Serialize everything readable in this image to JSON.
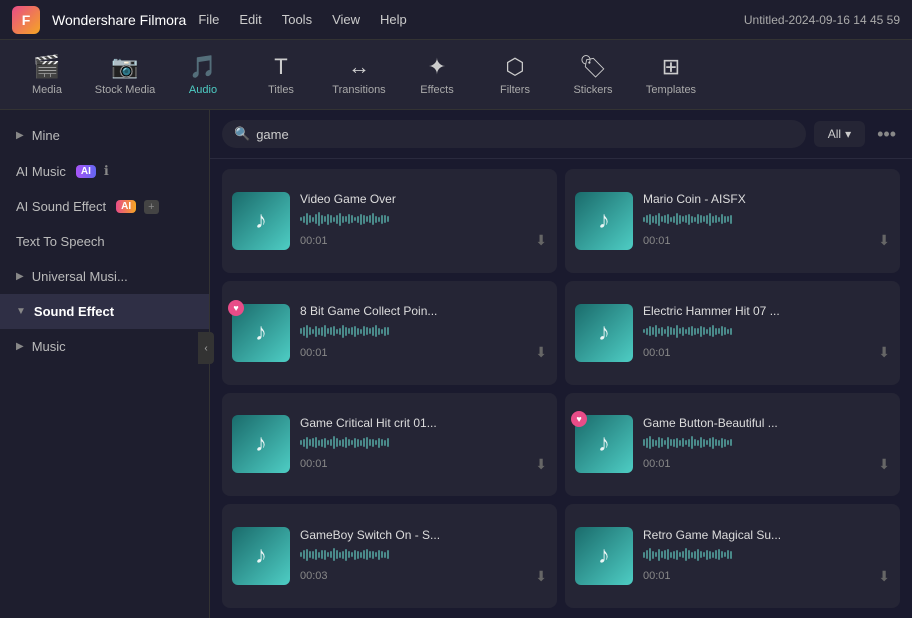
{
  "app": {
    "logo": "F",
    "name": "Wondershare Filmora",
    "menu": [
      "File",
      "Edit",
      "Tools",
      "View",
      "Help"
    ],
    "title": "Untitled-2024-09-16 14 45 59"
  },
  "toolbar": {
    "items": [
      {
        "id": "media",
        "label": "Media",
        "icon": "🎬",
        "active": false
      },
      {
        "id": "stock-media",
        "label": "Stock Media",
        "icon": "📷",
        "active": false
      },
      {
        "id": "audio",
        "label": "Audio",
        "icon": "🎵",
        "active": true
      },
      {
        "id": "titles",
        "label": "Titles",
        "icon": "T",
        "active": false
      },
      {
        "id": "transitions",
        "label": "Transitions",
        "icon": "↔",
        "active": false
      },
      {
        "id": "effects",
        "label": "Effects",
        "icon": "✦",
        "active": false
      },
      {
        "id": "filters",
        "label": "Filters",
        "icon": "⬡",
        "active": false
      },
      {
        "id": "stickers",
        "label": "Stickers",
        "icon": "🏷",
        "active": false
      },
      {
        "id": "templates",
        "label": "Templates",
        "icon": "⊞",
        "active": false
      }
    ]
  },
  "sidebar": {
    "items": [
      {
        "id": "mine",
        "label": "Mine",
        "type": "expandable",
        "active": false
      },
      {
        "id": "ai-music",
        "label": "AI Music",
        "type": "ai-badge",
        "active": false
      },
      {
        "id": "ai-sound-effect",
        "label": "AI Sound Effect",
        "type": "ai-badge2",
        "active": false
      },
      {
        "id": "text-to-speech",
        "label": "Text To Speech",
        "type": "plain",
        "active": false
      },
      {
        "id": "universal-music",
        "label": "Universal Musi...",
        "type": "expandable",
        "active": false
      },
      {
        "id": "sound-effect",
        "label": "Sound Effect",
        "type": "expandable",
        "active": true
      },
      {
        "id": "music",
        "label": "Music",
        "type": "expandable",
        "active": false
      }
    ],
    "collapse_label": "‹"
  },
  "search": {
    "placeholder": "game",
    "filter_label": "All",
    "filter_icon": "▾",
    "more_icon": "•••"
  },
  "sounds": [
    {
      "id": 1,
      "title": "Video Game Over",
      "duration": "00:01",
      "favorited": false,
      "waveform_heights": [
        4,
        7,
        12,
        8,
        5,
        10,
        14,
        9,
        6,
        11,
        8,
        5,
        9,
        13,
        7,
        6,
        10,
        8,
        4,
        7,
        11,
        9,
        6,
        8,
        12,
        7,
        5,
        9,
        8,
        6
      ]
    },
    {
      "id": 2,
      "title": "Mario Coin - AISFX",
      "duration": "00:01",
      "favorited": false,
      "waveform_heights": [
        5,
        8,
        11,
        7,
        9,
        13,
        6,
        8,
        10,
        5,
        7,
        12,
        9,
        6,
        8,
        11,
        7,
        5,
        10,
        8,
        6,
        9,
        13,
        7,
        8,
        5,
        10,
        7,
        6,
        9
      ]
    },
    {
      "id": 3,
      "title": "8 Bit Game Collect Poin...",
      "duration": "00:01",
      "favorited": true,
      "waveform_heights": [
        6,
        9,
        13,
        8,
        5,
        11,
        7,
        9,
        12,
        6,
        8,
        10,
        5,
        7,
        13,
        9,
        6,
        8,
        11,
        7,
        5,
        10,
        8,
        6,
        9,
        12,
        7,
        5,
        9,
        8
      ]
    },
    {
      "id": 4,
      "title": "Electric Hammer Hit 07 ...",
      "duration": "00:01",
      "favorited": false,
      "waveform_heights": [
        4,
        7,
        10,
        8,
        12,
        6,
        9,
        5,
        11,
        8,
        7,
        13,
        6,
        9,
        5,
        8,
        10,
        7,
        6,
        11,
        8,
        5,
        9,
        12,
        7,
        6,
        10,
        8,
        5,
        7
      ]
    },
    {
      "id": 5,
      "title": "Game Critical Hit crit 01...",
      "duration": "00:01",
      "favorited": false,
      "waveform_heights": [
        5,
        8,
        12,
        7,
        9,
        11,
        6,
        8,
        10,
        5,
        7,
        13,
        9,
        6,
        8,
        11,
        7,
        5,
        10,
        8,
        6,
        9,
        12,
        7,
        8,
        5,
        10,
        7,
        6,
        9
      ]
    },
    {
      "id": 6,
      "title": "Game Button-Beautiful ...",
      "duration": "00:01",
      "favorited": true,
      "waveform_heights": [
        7,
        10,
        13,
        8,
        6,
        11,
        9,
        5,
        12,
        7,
        8,
        10,
        6,
        9,
        5,
        8,
        13,
        7,
        6,
        11,
        8,
        5,
        9,
        12,
        7,
        6,
        10,
        8,
        5,
        7
      ]
    },
    {
      "id": 7,
      "title": "GameBoy Switch On - S...",
      "duration": "00:03",
      "favorited": false,
      "waveform_heights": [
        5,
        9,
        12,
        7,
        8,
        11,
        6,
        9,
        10,
        5,
        7,
        13,
        9,
        6,
        8,
        12,
        7,
        5,
        10,
        8,
        6,
        9,
        11,
        7,
        8,
        5,
        10,
        7,
        6,
        9
      ]
    },
    {
      "id": 8,
      "title": "Retro Game Magical Su...",
      "duration": "00:01",
      "favorited": false,
      "waveform_heights": [
        6,
        9,
        13,
        8,
        5,
        12,
        7,
        9,
        11,
        6,
        8,
        10,
        5,
        7,
        13,
        9,
        6,
        8,
        12,
        7,
        5,
        10,
        8,
        6,
        9,
        11,
        7,
        5,
        9,
        8
      ]
    }
  ]
}
